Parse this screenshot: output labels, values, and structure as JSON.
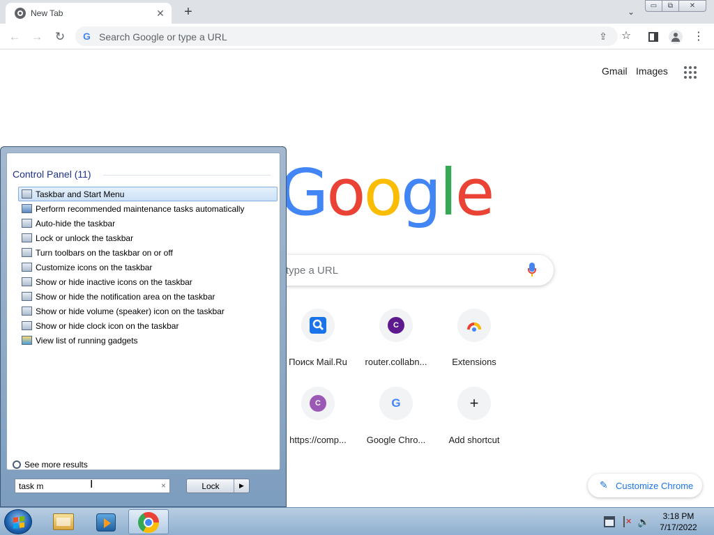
{
  "browser": {
    "tab": {
      "title": "New Tab",
      "close_glyph": "✕"
    },
    "new_tab_glyph": "+",
    "tab_search_glyph": "⌄",
    "window_controls": {
      "minimize": "▭",
      "restore": "⧉",
      "close": "✕"
    },
    "toolbar": {
      "back_glyph": "←",
      "forward_glyph": "→",
      "reload_glyph": "↻",
      "omnibox_placeholder": "Search Google or type a URL",
      "share_glyph": "⇪",
      "bookmark_glyph": "☆",
      "menu_glyph": "⋮"
    }
  },
  "ntp": {
    "links": {
      "gmail": "Gmail",
      "images": "Images"
    },
    "logo": {
      "letters": [
        "G",
        "o",
        "o",
        "g",
        "l",
        "e"
      ],
      "colors": [
        "#4285f4",
        "#ea4335",
        "#fbbc04",
        "#4285f4",
        "#34a853",
        "#ea4335"
      ]
    },
    "search_placeholder": "Search Google or type a URL",
    "search_visible_text": "type a URL",
    "shortcuts": [
      {
        "label": "Поиск Mail.Ru",
        "icon": "search-icon",
        "glyph": "🔍"
      },
      {
        "label": "router.collabn...",
        "icon": "letter-c-icon",
        "glyph": "C",
        "color": "#5c1a8e"
      },
      {
        "label": "Extensions",
        "icon": "chrome-extensions-icon",
        "glyph": ""
      },
      {
        "label": "https://comp...",
        "icon": "letter-c-icon",
        "glyph": "C",
        "color": "#9b59b6"
      },
      {
        "label": "Google Chro...",
        "icon": "google-g-icon",
        "glyph": "G"
      },
      {
        "label": "Add shortcut",
        "icon": "plus-icon",
        "glyph": "+"
      }
    ],
    "customize_label": "Customize Chrome",
    "customize_glyph": "✎"
  },
  "start_menu": {
    "results_header": "Control Panel (11)",
    "results": [
      {
        "label": "Taskbar and Start Menu",
        "icon": "taskbar-icon",
        "selected": true
      },
      {
        "label": "Perform recommended maintenance tasks automatically",
        "icon": "maintenance-icon",
        "selected": false
      },
      {
        "label": "Auto-hide the taskbar",
        "icon": "taskbar-icon",
        "selected": false
      },
      {
        "label": "Lock or unlock the taskbar",
        "icon": "taskbar-icon",
        "selected": false
      },
      {
        "label": "Turn toolbars on the taskbar on or off",
        "icon": "taskbar-icon",
        "selected": false
      },
      {
        "label": "Customize icons on the taskbar",
        "icon": "notification-icon",
        "selected": false
      },
      {
        "label": "Show or hide inactive icons on the taskbar",
        "icon": "notification-icon",
        "selected": false
      },
      {
        "label": "Show or hide the notification area on the taskbar",
        "icon": "notification-icon",
        "selected": false
      },
      {
        "label": "Show or hide volume (speaker) icon on the taskbar",
        "icon": "notification-icon",
        "selected": false
      },
      {
        "label": "Show or hide clock icon on the taskbar",
        "icon": "notification-icon",
        "selected": false
      },
      {
        "label": "View list of running gadgets",
        "icon": "gadget-icon",
        "selected": false
      }
    ],
    "see_more": "See more results",
    "search_value": "task m",
    "clear_glyph": "×",
    "lock_label": "Lock",
    "lock_arrow_glyph": "▶"
  },
  "taskbar": {
    "apps": [
      "windows-explorer",
      "windows-media-player",
      "google-chrome"
    ],
    "active_app": "google-chrome",
    "volume_glyph": "🔊",
    "clock": {
      "time": "3:18 PM",
      "date": "7/17/2022"
    }
  }
}
